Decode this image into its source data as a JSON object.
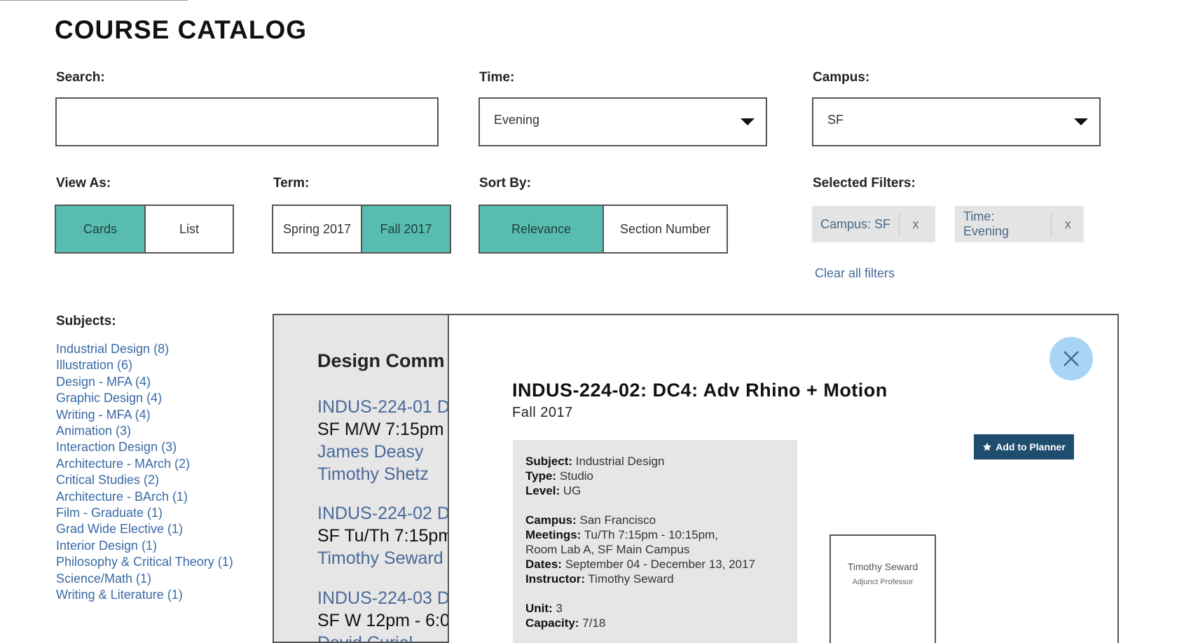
{
  "page": {
    "title": "COURSE CATALOG"
  },
  "labels": {
    "search": "Search:",
    "time": "Time:",
    "campus": "Campus:",
    "view_as": "View As:",
    "term": "Term:",
    "sort_by": "Sort By:",
    "selected_filters": "Selected Filters:",
    "subjects": "Subjects:"
  },
  "search": {
    "value": "",
    "placeholder": ""
  },
  "time_select": {
    "value": "Evening"
  },
  "campus_select": {
    "value": "SF"
  },
  "view_as": {
    "cards": "Cards",
    "list": "List",
    "selected": "Cards"
  },
  "term": {
    "spring": "Spring 2017",
    "fall": "Fall 2017",
    "selected": "Fall 2017"
  },
  "sort_by": {
    "relevance": "Relevance",
    "section": "Section Number",
    "selected": "Relevance"
  },
  "filters": [
    {
      "label": "Campus: SF",
      "remove": "x"
    },
    {
      "label": "Time: Evening",
      "remove": "x"
    }
  ],
  "clear_filters": "Clear all filters",
  "subjects": [
    "Industrial Design (8)",
    "Illustration (6)",
    "Design - MFA (4)",
    "Graphic Design (4)",
    "Writing - MFA (4)",
    "Animation (3)",
    "Interaction Design (3)",
    "Architecture - MArch (2)",
    "Critical Studies (2)",
    "Architecture - BArch (1)",
    "Film - Graduate (1)",
    "Grad Wide Elective (1)",
    "Interior Design (1)",
    "Philosophy & Critical Theory (1)",
    "Science/Math (1)",
    "Writing & Literature (1)"
  ],
  "results": {
    "heading": "Design Comm",
    "items": [
      {
        "code": "INDUS-224-01 D",
        "time": "SF M/W 7:15pm",
        "instructors": [
          "James Deasy",
          "Timothy Shetz"
        ]
      },
      {
        "code": "INDUS-224-02 D",
        "time": "SF Tu/Th 7:15pm",
        "instructors": [
          "Timothy Seward"
        ]
      },
      {
        "code": "INDUS-224-03 D",
        "time": "SF W 12pm - 6:0",
        "instructors": [
          "David Curiel"
        ]
      }
    ]
  },
  "detail": {
    "title": "INDUS-224-02: DC4: Adv Rhino + Motion",
    "term": "Fall 2017",
    "add_to_planner": "Add to Planner",
    "info": {
      "subject_label": "Subject:",
      "subject": "Industrial Design",
      "type_label": "Type:",
      "type": "Studio",
      "level_label": "Level:",
      "level": "UG",
      "campus_label": "Campus:",
      "campus": "San Francisco",
      "meetings_label": "Meetings:",
      "meetings_1": "Tu/Th 7:15pm - 10:15pm,",
      "meetings_2": "Room Lab A, SF Main Campus",
      "dates_label": "Dates:",
      "dates": "September 04 - December 13, 2017",
      "instructor_label": "Instructor:",
      "instructor": "Timothy Seward",
      "unit_label": "Unit:",
      "unit": "3",
      "capacity_label": "Capacity:",
      "capacity": "7/18"
    },
    "instructor_card": {
      "name": "Timothy Seward",
      "role": "Adjunct Professor"
    }
  },
  "colors": {
    "accent": "#58bdb0",
    "link": "#4a6a9a",
    "planner_button": "#1f4d6e",
    "close_button": "#a8d4f6",
    "panel_gray": "#e6e6e6"
  },
  "icons": [
    "caret-down-icon",
    "close-icon",
    "star-icon"
  ]
}
